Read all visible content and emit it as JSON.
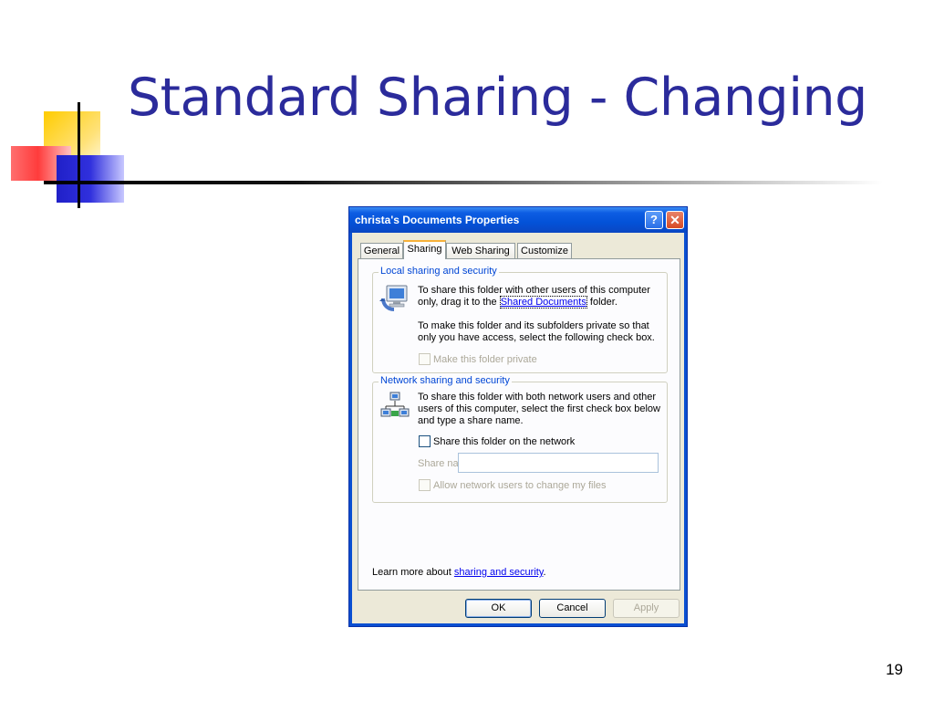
{
  "slide": {
    "title": "Standard Sharing - Changing",
    "page_number": "19"
  },
  "dialog": {
    "title": "christa's Documents Properties",
    "help_label": "?",
    "close_label": "✕",
    "tabs": [
      {
        "label": "General",
        "active": false
      },
      {
        "label": "Sharing",
        "active": true
      },
      {
        "label": "Web Sharing",
        "active": false
      },
      {
        "label": "Customize",
        "active": false
      }
    ],
    "local_group": {
      "label": "Local sharing and security",
      "text1": "To share this folder with other users of this computer",
      "text2_before": "only, drag it to the ",
      "text2_link": "Shared Documents",
      "text2_after": " folder.",
      "text3": "To make this folder and its subfolders private so that",
      "text4": "only you have access, select the following check box.",
      "private_checkbox_label": "Make this folder private"
    },
    "network_group": {
      "label": "Network sharing and security",
      "text1": "To share this folder with both network users and other",
      "text2": "users of this computer, select the first check box below",
      "text3": "and type a share name.",
      "share_checkbox_label": "Share this folder on the network",
      "share_name_label": "Share name:",
      "share_name_value": "",
      "allow_change_label": "Allow network users to change my files"
    },
    "learn_more_text": "Learn more about ",
    "learn_more_link": "sharing and security",
    "learn_more_end": ".",
    "buttons": {
      "ok": "OK",
      "cancel": "Cancel",
      "apply": "Apply"
    },
    "colors": {
      "title_bar": "#0352d8",
      "close_button": "#d64a25",
      "group_label": "#0046d5",
      "active_tab_accent": "#f7b13a"
    },
    "icons": {
      "local_group_icon": "computer-share-icon",
      "network_group_icon": "network-share-icon"
    }
  }
}
